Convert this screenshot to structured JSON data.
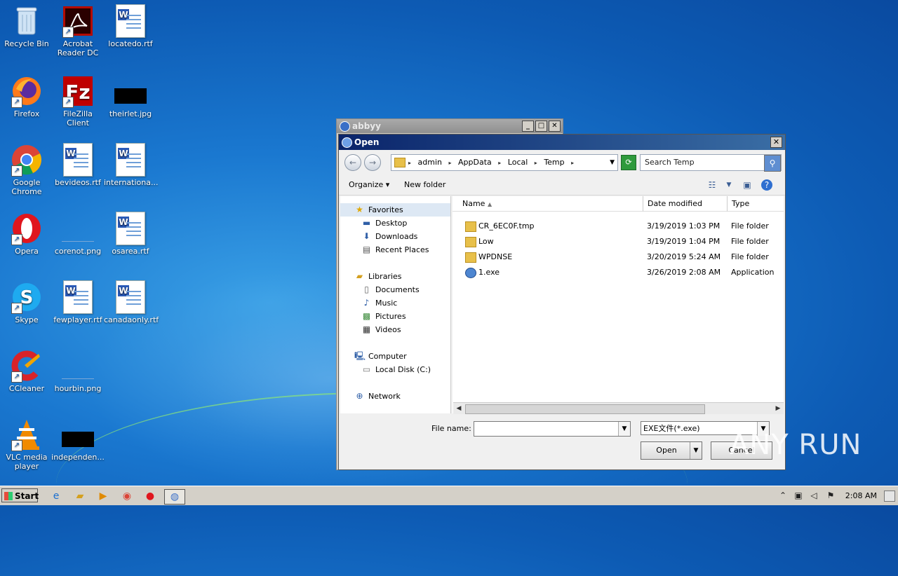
{
  "desktop": {
    "icons": [
      {
        "label": "Recycle Bin",
        "icon": "recycle-bin-icon"
      },
      {
        "label": "Acrobat Reader DC",
        "icon": "acrobat-icon"
      },
      {
        "label": "locatedo.rtf",
        "icon": "word-doc-icon"
      },
      {
        "label": "Firefox",
        "icon": "firefox-icon"
      },
      {
        "label": "FileZilla Client",
        "icon": "filezilla-icon"
      },
      {
        "label": "theirlet.jpg",
        "icon": "image-icon"
      },
      {
        "label": "Google Chrome",
        "icon": "chrome-icon"
      },
      {
        "label": "bevideos.rtf",
        "icon": "word-doc-icon"
      },
      {
        "label": "internationa...",
        "icon": "word-doc-icon"
      },
      {
        "label": "Opera",
        "icon": "opera-icon"
      },
      {
        "label": "corenot.png",
        "icon": "image-icon"
      },
      {
        "label": "osarea.rtf",
        "icon": "word-doc-icon"
      },
      {
        "label": "Skype",
        "icon": "skype-icon"
      },
      {
        "label": "fewplayer.rtf",
        "icon": "word-doc-icon"
      },
      {
        "label": "canadaonly.rtf",
        "icon": "word-doc-icon"
      },
      {
        "label": "CCleaner",
        "icon": "ccleaner-icon"
      },
      {
        "label": "hourbin.png",
        "icon": "image-icon"
      },
      {
        "label": "VLC media player",
        "icon": "vlc-icon"
      },
      {
        "label": "independen...",
        "icon": "image-icon"
      }
    ]
  },
  "abbyy_window": {
    "title": "abbyy"
  },
  "dialog": {
    "title": "Open",
    "breadcrumbs": [
      "admin",
      "AppData",
      "Local",
      "Temp"
    ],
    "search_placeholder": "Search Temp",
    "toolbar": {
      "organize": "Organize",
      "new_folder": "New folder"
    },
    "nav": {
      "favorites": "Favorites",
      "desktop": "Desktop",
      "downloads": "Downloads",
      "recent_places": "Recent Places",
      "libraries": "Libraries",
      "documents": "Documents",
      "music": "Music",
      "pictures": "Pictures",
      "videos": "Videos",
      "computer": "Computer",
      "local_disk": "Local Disk (C:)",
      "network": "Network"
    },
    "columns": {
      "name": "Name",
      "date": "Date modified",
      "type": "Type"
    },
    "files": [
      {
        "name": "CR_6EC0F.tmp",
        "date": "3/19/2019 1:03 PM",
        "type": "File folder",
        "kind": "folder"
      },
      {
        "name": "Low",
        "date": "3/19/2019 1:04 PM",
        "type": "File folder",
        "kind": "folder"
      },
      {
        "name": "WPDNSE",
        "date": "3/20/2019 5:24 AM",
        "type": "File folder",
        "kind": "folder"
      },
      {
        "name": "1.exe",
        "date": "3/26/2019 2:08 AM",
        "type": "Application",
        "kind": "exe"
      }
    ],
    "file_name_label": "File name:",
    "file_name_value": "",
    "file_type": "EXE文件(*.exe)",
    "open_button": "Open",
    "cancel_button": "Cancel"
  },
  "watermark": {
    "text": "ANY RUN"
  },
  "taskbar": {
    "start": "Start",
    "clock": "2:08 AM"
  }
}
